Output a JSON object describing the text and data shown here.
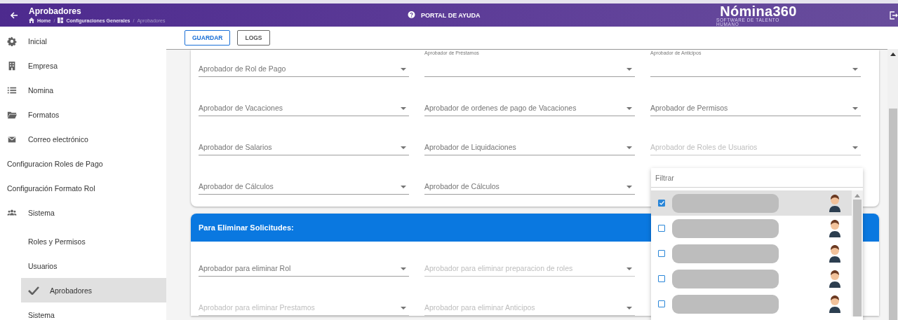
{
  "header": {
    "title": "Aprobadores",
    "breadcrumb": [
      {
        "label": "Home"
      },
      {
        "label": "Configuraciones Generales",
        "separator": "/"
      },
      {
        "label": "Aprobadores",
        "separator": "/"
      }
    ],
    "help_link": "PORTAL DE AYUDA",
    "logo": "Nómina360",
    "logo_tagline": "SOFTWARE DE TALENTO HUMANO"
  },
  "sidebar": {
    "items": [
      {
        "label": "Inicial",
        "selected": false
      },
      {
        "label": "Empresa",
        "selected": false
      },
      {
        "label": "Nomina",
        "selected": false
      },
      {
        "label": "Formatos",
        "selected": false
      },
      {
        "label": "Correo electrónico",
        "selected": false
      },
      {
        "label": "Configuracion Roles de Pago",
        "selected": false
      },
      {
        "label": "Configuración Formato Rol",
        "selected": false
      },
      {
        "label": "Sistema",
        "selected": false,
        "children": [
          {
            "label": "Roles y Permisos",
            "selected": false
          },
          {
            "label": "Usuarios",
            "selected": false
          },
          {
            "label": "Aprobadores",
            "selected": true
          },
          {
            "label": "Sistema",
            "selected": false
          }
        ]
      }
    ]
  },
  "toolbar": {
    "buttons": [
      {
        "label": "GUARDAR",
        "kind": "primary"
      },
      {
        "label": "LOGS",
        "kind": "default"
      }
    ]
  },
  "approvers_card": {
    "rows": [
      [
        {
          "label": "Aprobador de Rol de Pago",
          "kind": "placeholder",
          "disabled": false
        },
        {
          "label": "Aprobador de Préstamos",
          "kind": "floated",
          "disabled": false
        },
        {
          "label": "Aprobador de Anticipos",
          "kind": "floated",
          "disabled": false
        }
      ],
      [
        {
          "label": "Aprobador de Vacaciones",
          "kind": "placeholder",
          "disabled": false
        },
        {
          "label": "Aprobador de ordenes de pago de Vacaciones",
          "kind": "placeholder",
          "disabled": false
        },
        {
          "label": "Aprobador de Permisos",
          "kind": "placeholder",
          "disabled": false
        }
      ],
      [
        {
          "label": "Aprobador de Salarios",
          "kind": "placeholder",
          "disabled": false
        },
        {
          "label": "Aprobador de Liquidaciones",
          "kind": "placeholder",
          "disabled": false
        },
        {
          "label": "Aprobador de Roles de Usuarios",
          "kind": "placeholder",
          "disabled": true
        }
      ],
      [
        {
          "label": "Aprobador de Cálculos",
          "kind": "placeholder",
          "disabled": false
        },
        {
          "label": "Aprobador de Cálculos",
          "kind": "placeholder",
          "disabled": false
        }
      ]
    ]
  },
  "delete_card": {
    "title": "Para Eliminar Solicitudes:",
    "rows": [
      [
        {
          "label": "Aprobador para eliminar Rol",
          "kind": "placeholder",
          "disabled": false
        },
        {
          "label": "Aprobador para eliminar preparacion de roles",
          "kind": "placeholder",
          "disabled": true
        }
      ],
      [
        {
          "label": "Aprobador para eliminar Prestamos",
          "kind": "placeholder",
          "disabled": true
        },
        {
          "label": "Aprobador para eliminar Anticipos",
          "kind": "placeholder",
          "disabled": true
        }
      ]
    ]
  },
  "dropdown": {
    "filter_placeholder": "Filtrar",
    "options": [
      {
        "checked": true,
        "selected": true
      },
      {
        "checked": false,
        "selected": false
      },
      {
        "checked": false,
        "selected": false
      },
      {
        "checked": false,
        "selected": false
      },
      {
        "checked": false,
        "selected": false
      }
    ]
  }
}
